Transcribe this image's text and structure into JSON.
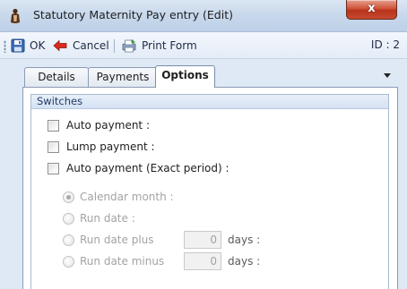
{
  "window": {
    "title": "Statutory Maternity Pay entry (Edit)",
    "close_label": "x"
  },
  "toolbar": {
    "ok_label": "OK",
    "cancel_label": "Cancel",
    "print_label": "Print Form",
    "id_label": "ID : 2"
  },
  "tabs": [
    {
      "label": "Details",
      "active": false
    },
    {
      "label": "Payments",
      "active": false
    },
    {
      "label": "Options",
      "active": true
    }
  ],
  "switches": {
    "title": "Switches",
    "checkboxes": [
      {
        "label": "Auto payment :",
        "checked": false
      },
      {
        "label": "Lump payment :",
        "checked": false
      },
      {
        "label": "Auto payment (Exact period) :",
        "checked": false
      }
    ],
    "radios": [
      {
        "label": "Calendar month :",
        "selected": true,
        "enabled": false
      },
      {
        "label": "Run date :",
        "selected": false,
        "enabled": false
      },
      {
        "label": "Run date plus",
        "selected": false,
        "enabled": false
      },
      {
        "label": "Run date minus",
        "selected": false,
        "enabled": false
      }
    ],
    "run_date_plus_value": "0",
    "run_date_minus_value": "0",
    "days_label": "days :"
  },
  "colors": {
    "accent": "#1f3a66",
    "close_button": "#c64a30",
    "disabled_text": "#a3a3a3"
  }
}
